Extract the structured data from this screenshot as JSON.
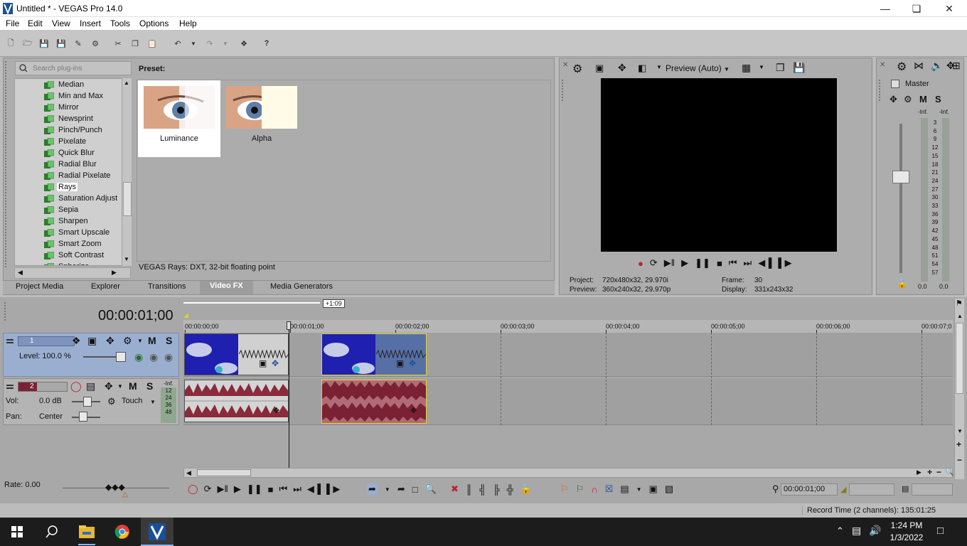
{
  "window": {
    "title": "Untitled * - VEGAS Pro 14.0"
  },
  "menu": [
    "File",
    "Edit",
    "View",
    "Insert",
    "Tools",
    "Options",
    "Help"
  ],
  "plugins": {
    "search_placeholder": "Search plug-ins",
    "items": [
      "Median",
      "Min and Max",
      "Mirror",
      "Newsprint",
      "Pinch/Punch",
      "Pixelate",
      "Quick Blur",
      "Radial Blur",
      "Radial Pixelate",
      "Rays",
      "Saturation Adjust",
      "Sepia",
      "Sharpen",
      "Smart Upscale",
      "Smart Zoom",
      "Soft Contrast",
      "Spherize"
    ],
    "selected": "Rays"
  },
  "preset": {
    "label": "Preset:",
    "items": [
      "Luminance",
      "Alpha"
    ],
    "status": "VEGAS Rays: DXT, 32-bit floating point"
  },
  "tabs": [
    "Project Media",
    "Explorer",
    "Transitions",
    "Video FX",
    "Media Generators"
  ],
  "active_tab": "Video FX",
  "preview": {
    "mode": "Preview (Auto)",
    "project_label": "Project:",
    "project_value": "720x480x32, 29.970i",
    "preview_label": "Preview:",
    "preview_value": "360x240x32, 29.970p",
    "frame_label": "Frame:",
    "frame_value": "30",
    "display_label": "Display:",
    "display_value": "331x243x32"
  },
  "mixer": {
    "title": "Master",
    "m": "M",
    "s": "S",
    "inf_left": "-Inf.",
    "inf_right": "-Inf.",
    "scale": [
      "3",
      "6",
      "9",
      "12",
      "15",
      "18",
      "21",
      "24",
      "27",
      "30",
      "33",
      "36",
      "39",
      "42",
      "45",
      "48",
      "51",
      "54",
      "57"
    ],
    "bottom_left": "0.0",
    "bottom_right": "0.0"
  },
  "timeline": {
    "time": "00:00:01;00",
    "marker": "+1:09",
    "ticks": [
      "00:00:00;00",
      "00:00:01;00",
      "00:00:02;00",
      "00:00:03;00",
      "00:00:04;00",
      "00:00:05;00",
      "00:00:06;00",
      "00:00:07;0"
    ],
    "playhead_fraction": 0.137
  },
  "track1": {
    "num": "1",
    "level": "Level: 100.0 %",
    "m": "M",
    "s": "S"
  },
  "track2": {
    "num": "2",
    "vol_label": "Vol:",
    "vol_value": "0.0 dB",
    "pan_label": "Pan:",
    "pan_value": "Center",
    "touch": "Touch",
    "m": "M",
    "s": "S",
    "meter": [
      "-Inf.",
      "12",
      "24",
      "36",
      "48"
    ]
  },
  "rate": "Rate: 0.00",
  "transport": {
    "time": "00:00:01;00"
  },
  "statusbar": {
    "record": "Record Time (2 channels): 135:01:25"
  },
  "taskbar": {
    "time": "1:24 PM",
    "date": "1/3/2022"
  },
  "colors": {
    "accent_track": "#9aaed0",
    "clip_video": "#1f1fb0",
    "clip_audio": "#8a2a3a",
    "selection": "#e4d228"
  }
}
